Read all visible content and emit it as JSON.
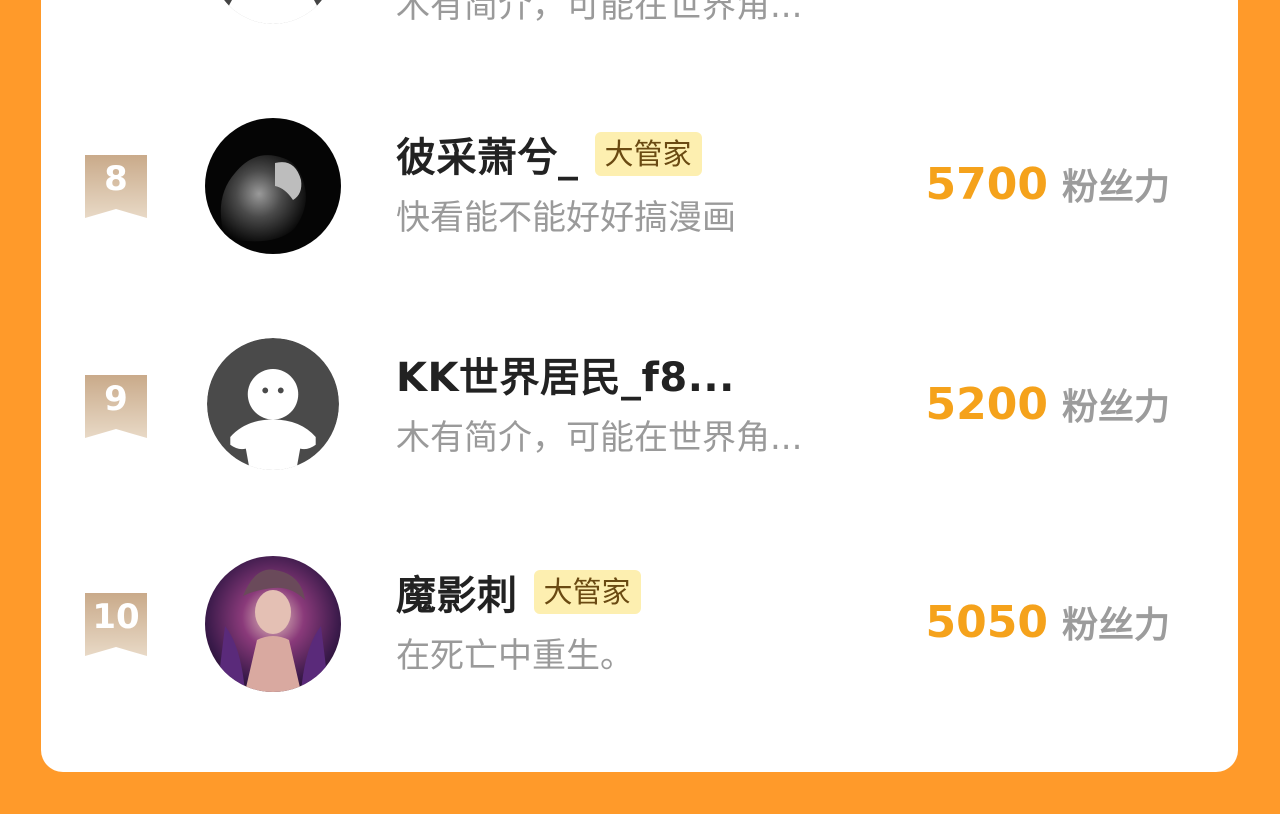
{
  "colors": {
    "page_background": "#FF9A2A",
    "card": "#FFFFFF",
    "rank_ribbon": "#D4B79B",
    "score": "#F5A21B",
    "badge_bg": "#FDEFB0"
  },
  "partial_row": {
    "bio": "木有简介，可能在世界角..."
  },
  "rows": [
    {
      "rank": "8",
      "name": "彼采萧兮_",
      "badge": "大管家",
      "bio": "快看能不能好好搞漫画",
      "score": "5700",
      "unit": "粉丝力",
      "avatar": "lion-avatar"
    },
    {
      "rank": "9",
      "name": "KK世界居民_f8...",
      "badge": "",
      "bio": "木有简介，可能在世界角...",
      "score": "5200",
      "unit": "粉丝力",
      "avatar": "default-avatar"
    },
    {
      "rank": "10",
      "name": "魔影刺",
      "badge": "大管家",
      "bio": "在死亡中重生。",
      "score": "5050",
      "unit": "粉丝力",
      "avatar": "anime-avatar"
    }
  ]
}
